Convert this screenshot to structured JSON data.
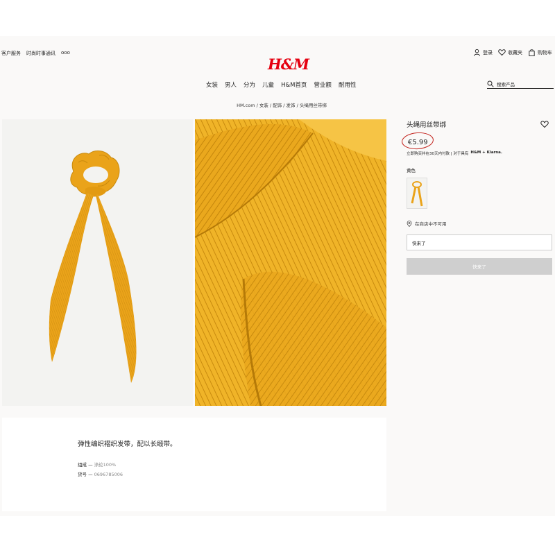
{
  "header": {
    "util_links": [
      "客户服务",
      "时尚时事通讯",
      "ooo"
    ],
    "logo": "H&M",
    "account": {
      "login": "登录",
      "favorites": "收藏夹",
      "cart": "购物车"
    },
    "nav": [
      "女装",
      "男人",
      "分为",
      "儿童",
      "H&M首页",
      "营业额",
      "耐用性"
    ],
    "search_placeholder": "搜索产品"
  },
  "breadcrumb": "HM.com / 女装 / 配饰 / 发饰 / 头绳用丝带绑",
  "product": {
    "title": "头绳用丝带绑",
    "price": "€5.99",
    "klarna_text": "立即购买并在30天内付款 | 对于具有",
    "klarna_brand": "H&M + Klarna.",
    "color_label": "黄色",
    "store_text": "在商店中不可用",
    "size_value": "快来了",
    "add_button": "快来了"
  },
  "description": {
    "main": "弹性编织褶织发带，配以长缎带。",
    "specs": [
      {
        "label": "组成",
        "value": "涤纶100%"
      },
      {
        "label": "货号",
        "value": "0696785006"
      }
    ]
  },
  "colors": {
    "brand_red": "#e50010",
    "product_yellow": "#e9a619",
    "circle_red": "#c2201a"
  }
}
